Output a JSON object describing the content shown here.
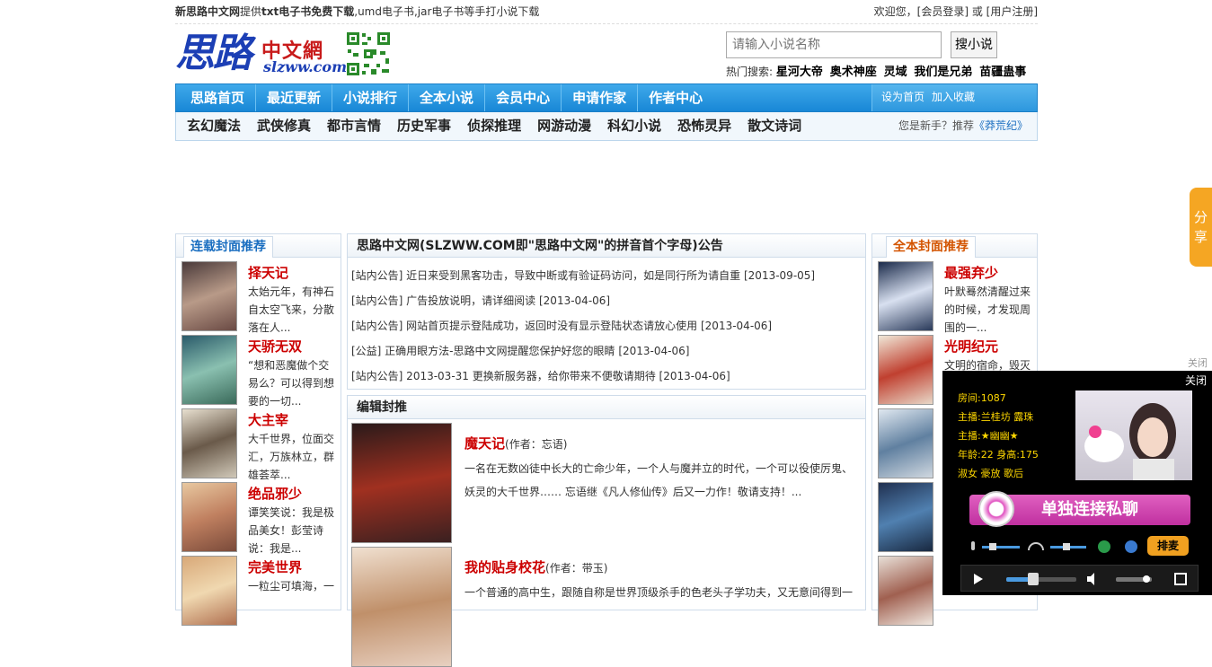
{
  "topbar": {
    "site_name": "新思路中文网",
    "intro_1": "提供",
    "intro_bold": "txt电子书免费下载",
    "intro_2": ",umd电子书,jar电子书等手打小说下载",
    "welcome": "欢迎您，[会员登录] 或 [用户注册]"
  },
  "header": {
    "logo_big": "思路",
    "logo_cn": "中文網",
    "logo_en": "slzww.com",
    "search_placeholder": "请输入小说名称",
    "search_button": "搜小说",
    "hot_label": "热门搜索:",
    "hot_items": [
      "星河大帝",
      "奥术神座",
      "灵域",
      "我们是兄弟",
      "苗疆蛊事"
    ]
  },
  "nav": {
    "items": [
      "思路首页",
      "最近更新",
      "小说排行",
      "全本小说",
      "会员中心",
      "申请作家",
      "作者中心"
    ],
    "set_home": "设为首页",
    "bookmark": "加入收藏"
  },
  "subnav": {
    "items": [
      "玄幻魔法",
      "武侠修真",
      "都市言情",
      "历史军事",
      "侦探推理",
      "网游动漫",
      "科幻小说",
      "恐怖灵异",
      "散文诗词"
    ],
    "rec_prefix": "您是新手？推荐",
    "rec_book": "《莽荒纪》"
  },
  "left": {
    "title": "连载封面推荐",
    "books": [
      {
        "name": "择天记",
        "desc": "太始元年，有神石自太空飞来，分散落在人..."
      },
      {
        "name": "天骄无双",
        "desc": "“想和恶魔做个交易么？可以得到想要的一切..."
      },
      {
        "name": "大主宰",
        "desc": "大千世界，位面交汇，万族林立，群雄荟萃..."
      },
      {
        "name": "绝品邪少",
        "desc": "谭笑笑说：我是极品美女！彭莹诗说：我是..."
      },
      {
        "name": "完美世界",
        "desc": "一粒尘可填海，一"
      }
    ]
  },
  "notice": {
    "title": "思路中文网(SLZWW.COM即\"思路中文网\"的拼音首个字母)公告",
    "items": [
      "[站内公告] 近日来受到黑客功击，导致中断或有验证码访问，如是同行所为请自重 [2013-09-05]",
      "[站内公告] 广告投放说明，请详细阅读 [2013-04-06]",
      "[站内公告] 网站首页提示登陆成功，返回时没有显示登陆状态请放心使用 [2013-04-06]",
      "[公益] 正确用眼方法-思路中文网提醒您保护好您的眼睛 [2013-04-06]",
      "[站内公告] 2013-03-31 更换新服务器，给你带来不便敬请期待 [2013-04-06]"
    ]
  },
  "editor": {
    "title": "编辑封推",
    "books": [
      {
        "name": "魔天记",
        "author": "(作者：忘语)",
        "desc": "一名在无数凶徒中长大的亡命少年，一个人与魔并立的时代，一个可以役使厉鬼、妖灵的大千世界…… 忘语继《凡人修仙传》后又一力作！敬请支持！..."
      },
      {
        "name": "我的贴身校花",
        "author": "(作者：带玉)",
        "desc": "一个普通的高中生，跟随自称是世界顶级杀手的色老头子学功夫，又无意间得到一"
      }
    ]
  },
  "right": {
    "title": "全本封面推荐",
    "books": [
      {
        "name": "最强弃少",
        "desc": "叶默蓦然清醒过来的时候，才发现周围的一..."
      },
      {
        "name": "光明纪元",
        "desc": "文明的宿命，毁灭"
      }
    ]
  },
  "share": {
    "label": "分享"
  },
  "popup": {
    "close_outer": "关闭",
    "close_inner": "关闭",
    "room": "房间:1087",
    "host1": "主播:兰桂坊 露珠",
    "host2": "主播:★幽幽★",
    "age": "年龄:22  身高:175",
    "tags": "淑女 豪放 歌后",
    "banner": "单独连接私聊",
    "paimai": "排麦"
  }
}
